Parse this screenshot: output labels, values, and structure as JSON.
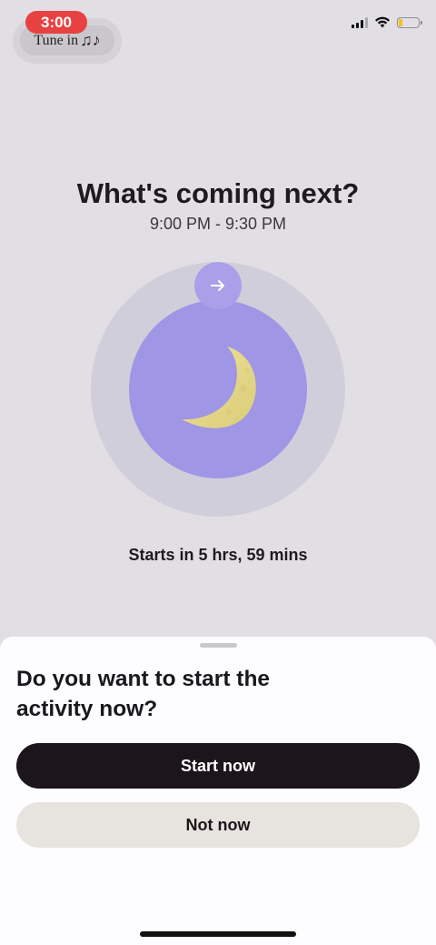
{
  "status_bar": {
    "time": "3:00",
    "media_chip": "Tune in",
    "media_note": "♫♪",
    "signal_icon": "cellular-signal-icon",
    "wifi_icon": "wifi-icon",
    "battery_icon": "battery-low-icon"
  },
  "main": {
    "heading": "What's coming next?",
    "time_range": "9:00 PM - 9:30 PM",
    "next_icon": "arrow-right-icon",
    "center_icon": "moon-icon",
    "starts_in": "Starts in 5 hrs, 59 mins"
  },
  "sheet": {
    "title": "Do you want to start the activity now?",
    "start_label": "Start now",
    "not_now_label": "Not now"
  },
  "colors": {
    "background": "#e1dfe3",
    "accent_purple": "#a096e6",
    "outer_ring": "#d1cedb",
    "moon": "#e5d98a",
    "primary_button": "#1c151a",
    "secondary_button": "#e7e3de",
    "recording_pill": "#e84141"
  }
}
